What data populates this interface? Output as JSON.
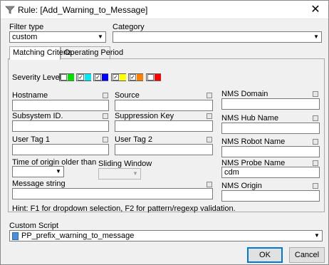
{
  "window": {
    "title": "Rule: [Add_Warning_to_Message]"
  },
  "filter_type": {
    "label": "Filter type",
    "value": "custom"
  },
  "category": {
    "label": "Category",
    "value": ""
  },
  "tabs": [
    {
      "label": "Matching Criteria"
    },
    {
      "label": "Operating Period"
    }
  ],
  "severity": {
    "label": "Severity Level",
    "levels": [
      {
        "checked": "",
        "color": "#00e000"
      },
      {
        "checked": "✓",
        "color": "#00e8f0"
      },
      {
        "checked": "✓",
        "color": "#0000ff"
      },
      {
        "checked": "✓",
        "color": "#ffff00"
      },
      {
        "checked": "✓",
        "color": "#ff8000"
      },
      {
        "checked": "",
        "color": "#ff0000"
      }
    ]
  },
  "fields": {
    "hostname": {
      "label": "Hostname",
      "value": ""
    },
    "source": {
      "label": "Source",
      "value": ""
    },
    "nms_domain": {
      "label": "NMS Domain",
      "value": ""
    },
    "subsystem_id": {
      "label": "Subsystem ID.",
      "value": ""
    },
    "suppression_key": {
      "label": "Suppression Key",
      "value": ""
    },
    "nms_hub_name": {
      "label": "NMS Hub Name",
      "value": ""
    },
    "user_tag_1": {
      "label": "User Tag 1",
      "value": ""
    },
    "user_tag_2": {
      "label": "User Tag 2",
      "value": ""
    },
    "nms_robot_name": {
      "label": "NMS Robot Name",
      "value": ""
    },
    "time_of_origin": {
      "label": "Time of origin older than",
      "value": ""
    },
    "sliding_window": {
      "label": "Sliding Window",
      "value": ""
    },
    "nms_probe_name": {
      "label": "NMS Probe Name",
      "value": "cdm"
    },
    "message_string": {
      "label": "Message string",
      "value": ""
    },
    "nms_origin": {
      "label": "NMS Origin",
      "value": ""
    }
  },
  "hint": "Hint: F1 for dropdown selection, F2 for pattern/regexp validation.",
  "custom_script": {
    "label": "Custom Script",
    "value": "PP_prefix_warning_to_message"
  },
  "buttons": {
    "ok": "OK",
    "cancel": "Cancel"
  }
}
